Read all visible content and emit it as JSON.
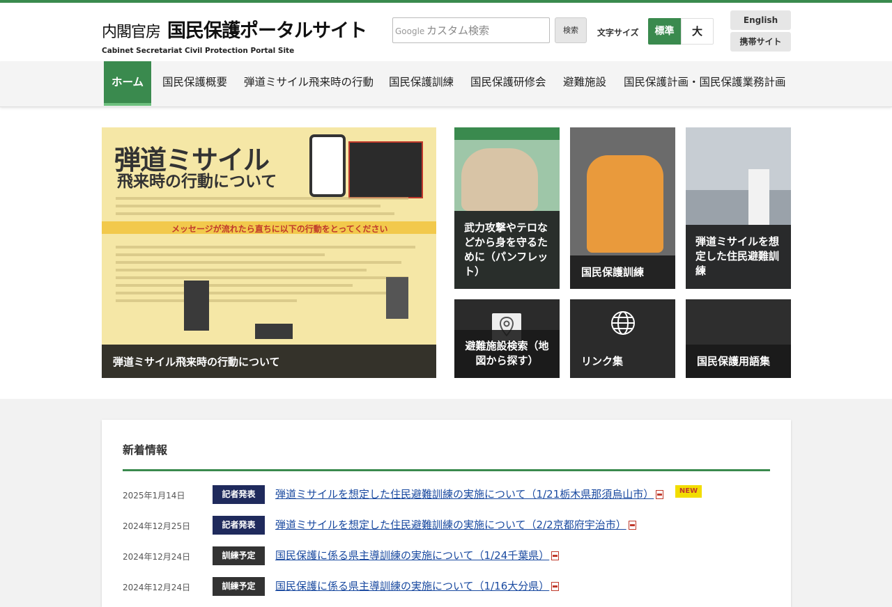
{
  "header": {
    "org": "内閣官房",
    "site_title": "国民保護ポータルサイト",
    "subtitle": "Cabinet Secretariat Civil Protection Portal Site",
    "search": {
      "brand": "Google",
      "placeholder": "カスタム検索",
      "button": "検索"
    },
    "font_size": {
      "label": "文字サイズ",
      "normal": "標準",
      "large": "大",
      "selected": "標準"
    },
    "english": "English",
    "mobile": "携帯サイト"
  },
  "nav": {
    "items": [
      {
        "label": "ホーム",
        "active": true
      },
      {
        "label": "国民保護概要"
      },
      {
        "label": "弾道ミサイル飛来時の行動"
      },
      {
        "label": "国民保護訓練"
      },
      {
        "label": "国民保護研修会"
      },
      {
        "label": "避難施設"
      },
      {
        "label": "国民保護計画・国民保護業務計画"
      }
    ]
  },
  "hero": {
    "heading1": "弾道ミサイル",
    "heading2": "飛来時の行動について",
    "warning": "メッセージが流れたら直ちに以下の行動をとってください",
    "caption": "弾道ミサイル飛来時の行動について"
  },
  "tiles": [
    {
      "caption": "武力攻撃やテロなどから身を守るために（パンフレット）"
    },
    {
      "caption": "国民保護訓練"
    },
    {
      "caption": "弾道ミサイルを想定した住民避難訓練"
    },
    {
      "caption": "避難施設検索（地図から探す）",
      "icon": "map-pin-icon"
    },
    {
      "caption": "リンク集",
      "icon": "globe-icon"
    },
    {
      "caption": "国民保護用語集"
    }
  ],
  "news": {
    "title": "新着情報",
    "colors": {
      "press": "#1f2a5c",
      "training": "#333333",
      "accent": "#3a8a4e"
    },
    "items": [
      {
        "date": "2025年1月14日",
        "badge": "記者発表",
        "type": "press",
        "text": "弾道ミサイルを想定した住民避難訓練の実施について（1/21栃木県那須烏山市）",
        "is_new": true,
        "new_label": "NEW"
      },
      {
        "date": "2024年12月25日",
        "badge": "記者発表",
        "type": "press",
        "text": "弾道ミサイルを想定した住民避難訓練の実施について（2/2京都府宇治市）"
      },
      {
        "date": "2024年12月24日",
        "badge": "訓練予定",
        "type": "training",
        "text": "国民保護に係る県主導訓練の実施について（1/24千葉県）"
      },
      {
        "date": "2024年12月24日",
        "badge": "訓練予定",
        "type": "training",
        "text": "国民保護に係る県主導訓練の実施について（1/16大分県）"
      }
    ]
  }
}
